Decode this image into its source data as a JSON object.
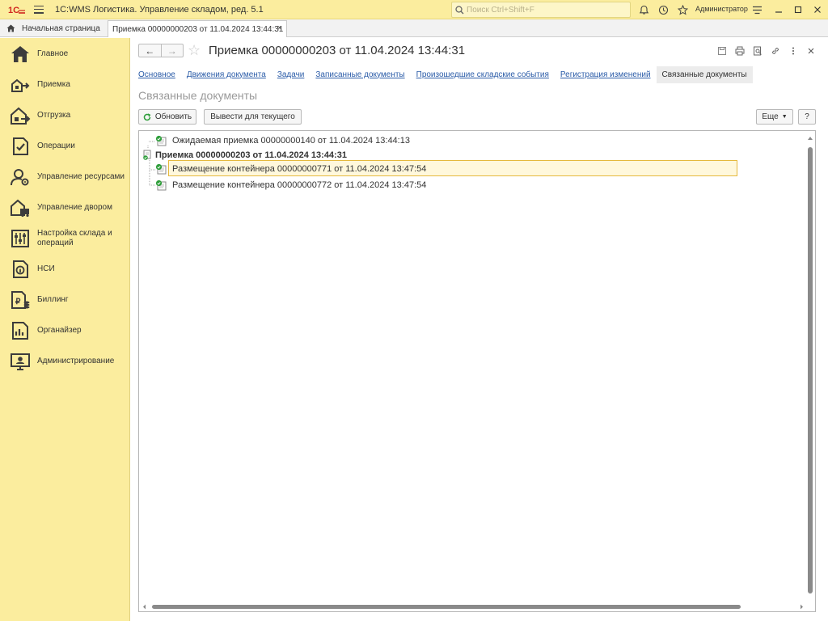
{
  "app": {
    "title": "1С:WMS Логистика. Управление складом, ред. 5.1",
    "logo_icon": "1c-logo-icon",
    "search_placeholder": "Поиск Ctrl+Shift+F",
    "user": "Администратор"
  },
  "tabs": {
    "home_label": "Начальная страница",
    "document_label": "Приемка 00000000203 от 11.04.2024 13:44:31",
    "close_symbol": "×"
  },
  "sidebar": {
    "items": [
      {
        "label": "Главное",
        "icon": "home-icon"
      },
      {
        "label": "Приемка",
        "icon": "receiving-icon"
      },
      {
        "label": "Отгрузка",
        "icon": "shipping-icon"
      },
      {
        "label": "Операции",
        "icon": "operations-icon"
      },
      {
        "label": "Управление ресурсами",
        "icon": "resources-icon"
      },
      {
        "label": "Управление двором",
        "icon": "yard-icon"
      },
      {
        "label": "Настройка склада и операций",
        "icon": "settings-icon"
      },
      {
        "label": "НСИ",
        "icon": "info-icon"
      },
      {
        "label": "Биллинг",
        "icon": "billing-icon"
      },
      {
        "label": "Органайзер",
        "icon": "organizer-icon"
      },
      {
        "label": "Администрирование",
        "icon": "admin-icon"
      }
    ]
  },
  "document": {
    "title": "Приемка 00000000203 от 11.04.2024 13:44:31",
    "nav_back": "←",
    "nav_forward": "→",
    "links": [
      "Основное",
      "Движения документа",
      "Задачи",
      "Записанные документы",
      "Произошедшие складские события",
      "Регистрация изменений"
    ],
    "active_link": "Связанные документы",
    "section_title": "Связанные документы"
  },
  "toolbar": {
    "refresh_label": "Обновить",
    "output_label": "Вывести для текущего",
    "more_label": "Еще",
    "help_label": "?"
  },
  "tree": {
    "rows": [
      {
        "text": "Ожидаемая приемка 00000000140 от 11.04.2024 13:44:13",
        "bold": false
      },
      {
        "text": "Приемка 00000000203 от 11.04.2024 13:44:31",
        "bold": true
      },
      {
        "text": "Размещение контейнера 00000000771 от 11.04.2024 13:47:54",
        "bold": false,
        "selected": true
      },
      {
        "text": "Размещение контейнера 00000000772 от 11.04.2024 13:47:54",
        "bold": false
      }
    ]
  },
  "colors": {
    "accent_yellow": "#fbed9e",
    "link_blue": "#2b5ca8",
    "doc_green": "#2e9e3a",
    "selection_border": "#e5b93d"
  }
}
